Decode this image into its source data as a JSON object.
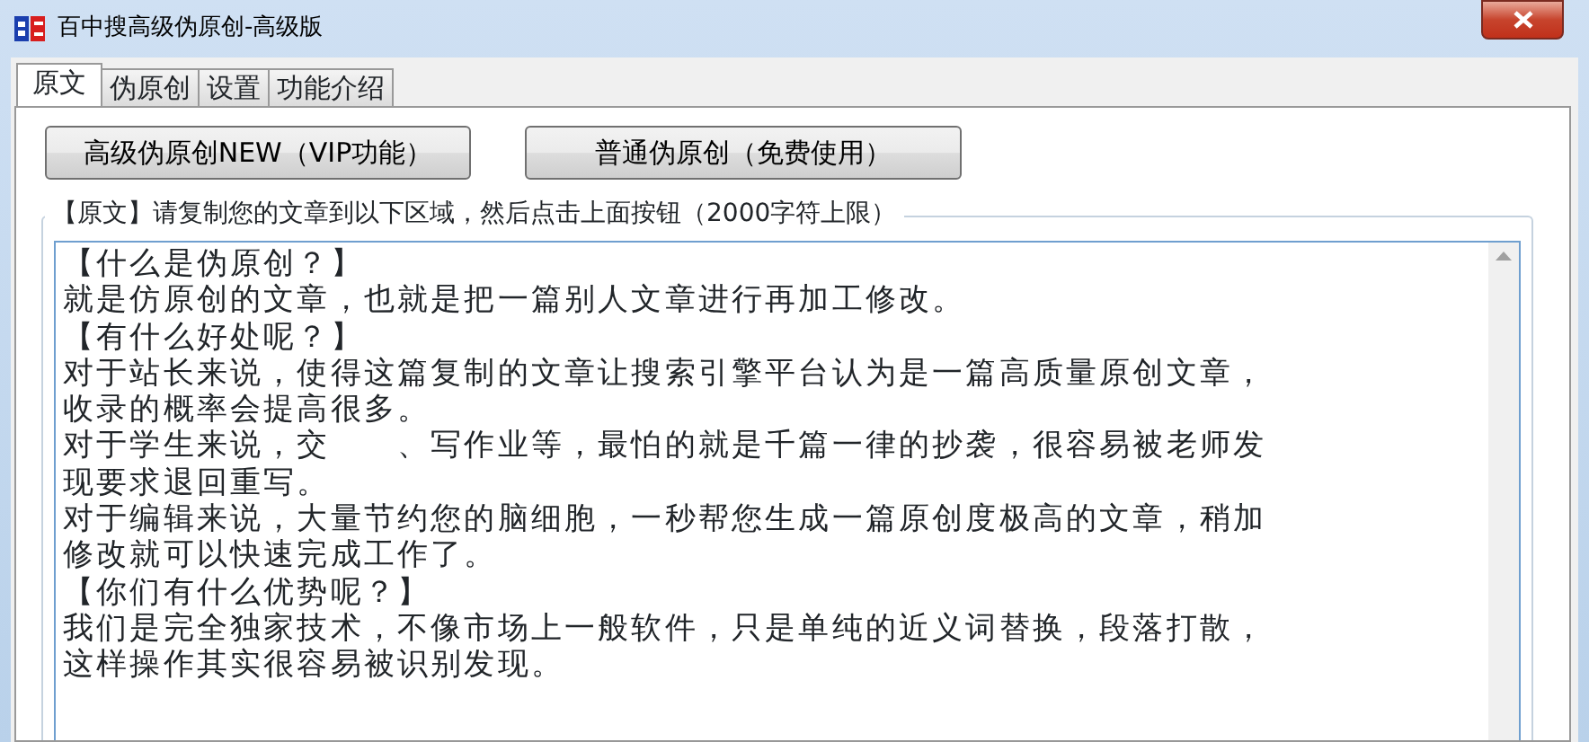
{
  "window": {
    "title": "百中搜高级伪原创-高级版"
  },
  "tabs": [
    {
      "label": "原文",
      "selected": true
    },
    {
      "label": "伪原创",
      "selected": false
    },
    {
      "label": "设置",
      "selected": false
    },
    {
      "label": "功能介绍",
      "selected": false
    }
  ],
  "buttons": [
    "高级伪原创NEW（VIP功能）",
    "普通伪原创（免费使用）"
  ],
  "group": {
    "label": "【原文】请复制您的文章到以下区域，然后点击上面按钮（2000字符上限）"
  },
  "text_lines": [
    "【什么是伪原创？】",
    "就是仿原创的文章，也就是把一篇别人文章进行再加工修改。",
    "【有什么好处呢？】",
    "对于站长来说，使得这篇复制的文章让搜索引擎平台认为是一篇高质量原创文章，",
    "收录的概率会提高很多。",
    "对于学生来说，交　　、写作业等，最怕的就是千篇一律的抄袭，很容易被老师发",
    "现要求退回重写。",
    "对于编辑来说，大量节约您的脑细胞，一秒帮您生成一篇原创度极高的文章，稍加",
    "修改就可以快速完成工作了。",
    "【你们有什么优势呢？】",
    "我们是完全独家技术，不像市场上一般软件，只是单纯的近义词替换，段落打散，",
    "这样操作其实很容易被识别发现。"
  ]
}
